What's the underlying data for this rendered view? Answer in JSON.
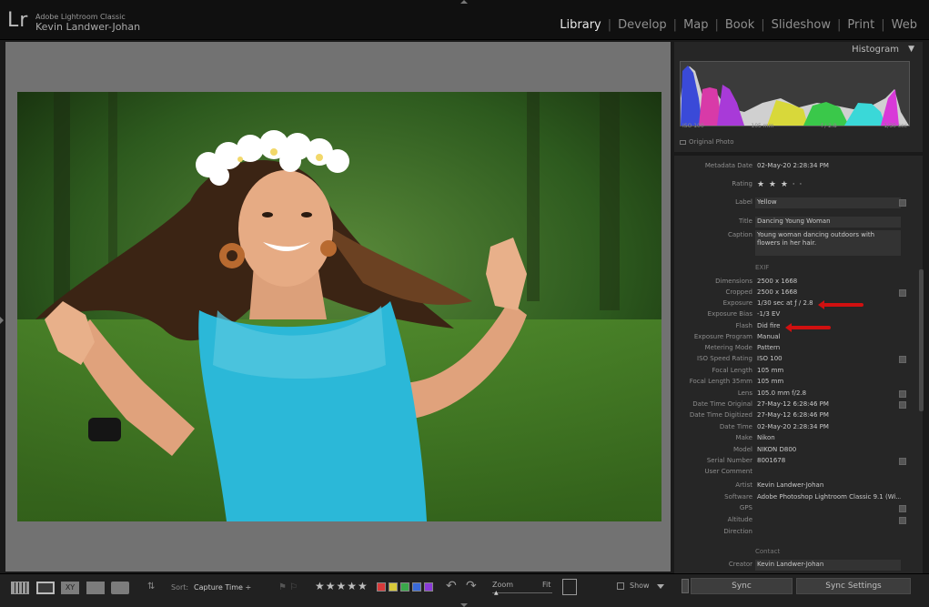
{
  "app": {
    "logo": "Lr",
    "name": "Adobe Lightroom Classic",
    "user": "Kevin Landwer-Johan"
  },
  "modules": [
    "Library",
    "Develop",
    "Map",
    "Book",
    "Slideshow",
    "Print",
    "Web"
  ],
  "active_module": "Library",
  "histogram": {
    "title": "Histogram",
    "toggle": "▼",
    "iso": "ISO 100",
    "focal": "105 mm",
    "aperture": "f / 2.8",
    "shutter": "1/30 sec",
    "original_photo": "Original Photo"
  },
  "metadata": {
    "rows": [
      {
        "label": "Metadata Date",
        "value": "02-May-20 2:28:34 PM"
      },
      {
        "label": "Rating",
        "value": "★ ★ ★ ·  ·"
      },
      {
        "label": "Label",
        "value": "Yellow"
      },
      {
        "label": "Title",
        "value": "Dancing Young Woman"
      },
      {
        "label": "Caption",
        "value": "Young woman dancing outdoors with flowers in her hair."
      },
      {
        "label": "Dimensions",
        "value": "2500 x 1668"
      },
      {
        "label": "Cropped",
        "value": "2500 x 1668"
      },
      {
        "label": "Exposure",
        "value": "1/30 sec at ƒ / 2.8"
      },
      {
        "label": "Exposure Bias",
        "value": "-1/3 EV"
      },
      {
        "label": "Flash",
        "value": "Did fire"
      },
      {
        "label": "Exposure Program",
        "value": "Manual"
      },
      {
        "label": "Metering Mode",
        "value": "Pattern"
      },
      {
        "label": "ISO Speed Rating",
        "value": "ISO 100"
      },
      {
        "label": "Focal Length",
        "value": "105 mm"
      },
      {
        "label": "Focal Length 35mm",
        "value": "105 mm"
      },
      {
        "label": "Lens",
        "value": "105.0 mm f/2.8"
      },
      {
        "label": "Date Time Original",
        "value": "27-May-12 6:28:46 PM"
      },
      {
        "label": "Date Time Digitized",
        "value": "27-May-12 6:28:46 PM"
      },
      {
        "label": "Date Time",
        "value": "02-May-20 2:28:34 PM"
      },
      {
        "label": "Make",
        "value": "Nikon"
      },
      {
        "label": "Model",
        "value": "NIKON D800"
      },
      {
        "label": "Serial Number",
        "value": "8001678"
      },
      {
        "label": "User Comment",
        "value": ""
      },
      {
        "label": "Artist",
        "value": "Kevin Landwer-Johan"
      },
      {
        "label": "Software",
        "value": "Adobe Photoshop Lightroom Classic 9.1 (Wi..."
      },
      {
        "label": "GPS",
        "value": ""
      },
      {
        "label": "Altitude",
        "value": ""
      },
      {
        "label": "Direction",
        "value": ""
      },
      {
        "label": "Creator",
        "value": "Kevin Landwer-Johan"
      }
    ],
    "exif_header": "EXIF",
    "contact_header": "Contact"
  },
  "toolbar": {
    "sort_label": "Sort:",
    "sort_value": "Capture Time ÷",
    "rating": "★★★★★",
    "zoom_label": "Zoom",
    "zoom_fit": "Fit",
    "show_label": "Show",
    "sync_label": "Sync",
    "sync_settings_label": "Sync Settings",
    "color_labels": [
      "#d83a3a",
      "#d8c93a",
      "#3aa84a",
      "#3a6ad8",
      "#8a3ad8"
    ]
  }
}
